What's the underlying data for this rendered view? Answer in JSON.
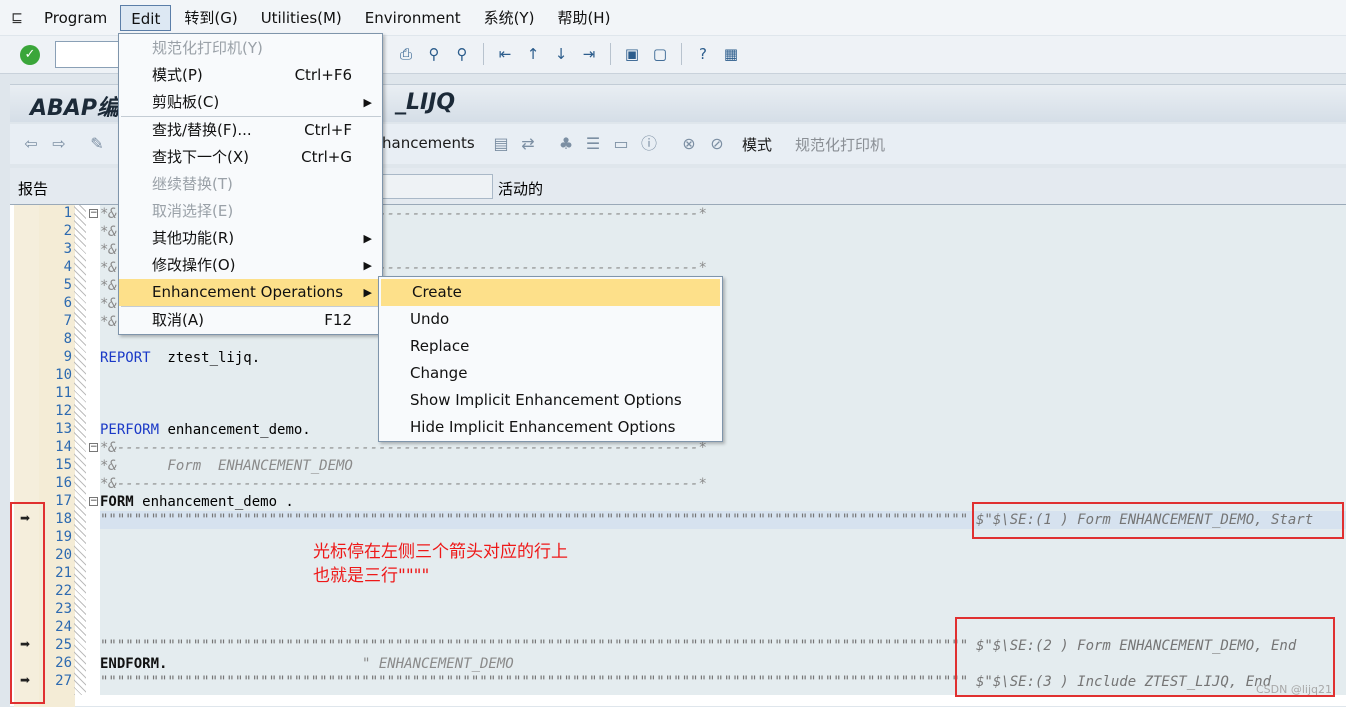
{
  "menubar": {
    "sys_icon": "system-menu-icon",
    "items": [
      "Program",
      "Edit",
      "转到(G)",
      "Utilities(M)",
      "Environment",
      "系统(Y)",
      "帮助(H)"
    ]
  },
  "title": {
    "prefix": "ABAP编",
    "suffix": "_LIJQ"
  },
  "app_toolbar": {
    "enhancements": "hancements",
    "mode": "模式",
    "pretty_printer": "规范化打印机"
  },
  "report": {
    "label": "报告",
    "status": "活动的"
  },
  "edit_menu": {
    "items": [
      {
        "label": "规范化打印机(Y)",
        "shortcut": "",
        "submenu": false,
        "disabled": true
      },
      {
        "label": "模式(P)",
        "shortcut": "Ctrl+F6",
        "submenu": false,
        "disabled": false
      },
      {
        "label": "剪贴板(C)",
        "shortcut": "",
        "submenu": true,
        "disabled": false
      },
      {
        "label": "查找/替换(F)...",
        "shortcut": "Ctrl+F",
        "submenu": false,
        "disabled": false
      },
      {
        "label": "查找下一个(X)",
        "shortcut": "Ctrl+G",
        "submenu": false,
        "disabled": false
      },
      {
        "label": "继续替换(T)",
        "shortcut": "",
        "submenu": false,
        "disabled": true
      },
      {
        "label": "取消选择(E)",
        "shortcut": "",
        "submenu": false,
        "disabled": true
      },
      {
        "label": "其他功能(R)",
        "shortcut": "",
        "submenu": true,
        "disabled": false
      },
      {
        "label": "修改操作(O)",
        "shortcut": "",
        "submenu": true,
        "disabled": false
      },
      {
        "label": "Enhancement Operations",
        "shortcut": "",
        "submenu": true,
        "disabled": false
      },
      {
        "label": "取消(A)",
        "shortcut": "F12",
        "submenu": false,
        "disabled": false
      }
    ]
  },
  "enh_menu": {
    "items": [
      "Create",
      "Undo",
      "Replace",
      "Change",
      "Show Implicit Enhancement Options",
      "Hide Implicit Enhancement Options"
    ]
  },
  "code": {
    "line_numbers": [
      "1",
      "2",
      "3",
      "4",
      "5",
      "6",
      "7",
      "8",
      "9",
      "10",
      "11",
      "12",
      "13",
      "14",
      "15",
      "16",
      "17",
      "18",
      "19",
      "20",
      "21",
      "22",
      "23",
      "24",
      "25",
      "26",
      "27"
    ],
    "l1": "*&---------------------------------------------------------------------*",
    "l2": "*&",
    "l3": "*&",
    "l4": "*&---------------------------------------------------------------------*",
    "l5": "*&",
    "l6": "*&",
    "l7": "*&---------------------------------------------------------------------*",
    "l9_kw": "REPORT",
    "l9_rest": "  ztest_lijq.",
    "l13_kw": "PERFORM",
    "l13_rest": " enhancement_demo.",
    "l14": "*&---------------------------------------------------------------------*",
    "l15": "*&      Form  ENHANCEMENT_DEMO",
    "l16": "*&---------------------------------------------------------------------*",
    "l17_kw": "FORM",
    "l17_rest": " enhancement_demo .",
    "enh_quotes": "\"\"\"\"\"\"\"\"\"\"\"\"\"\"\"\"\"\"\"\"\"\"\"\"\"\"\"\"\"\"\"\"\"\"\"\"\"\"\"\"\"\"\"\"\"\"\"\"\"\"\"\"\"\"\"\"\"\"\"\"\"\"\"\"\"\"\"\"\"\"\"\"\"\"\"\"\"\"\"\"\"\"\"\"\"\"\"\"\"\"\"\"\"\"\"\"\"\"\"\"\"\"\"\"\"\"\"\"\"\"\"\"\"\"\"\"\"\"\"\"\"\"\"\"\"\"\"\"\"\"\"\"\"\"\"\"\"\"\"\"\"\"\"\"\"\"\"\"\"\"\"\"\"\"\"\"\"\"\"\"\"\"",
    "l18_tail": "$\"$\\SE:(1 ) Form ENHANCEMENT_DEMO, Start",
    "l25_tail": "$\"$\\SE:(2 ) Form ENHANCEMENT_DEMO, End",
    "l26_kw": "ENDFORM.",
    "l26_comment": "\" ENHANCEMENT_DEMO",
    "l27_tail": "$\"$\\SE:(3 ) Include ZTEST_LIJQ, End"
  },
  "annotation": {
    "line1": "光标停在左侧三个箭头对应的行上",
    "line2": "也就是三行\"\"\"\""
  },
  "watermark": "CSDN @lijq21"
}
